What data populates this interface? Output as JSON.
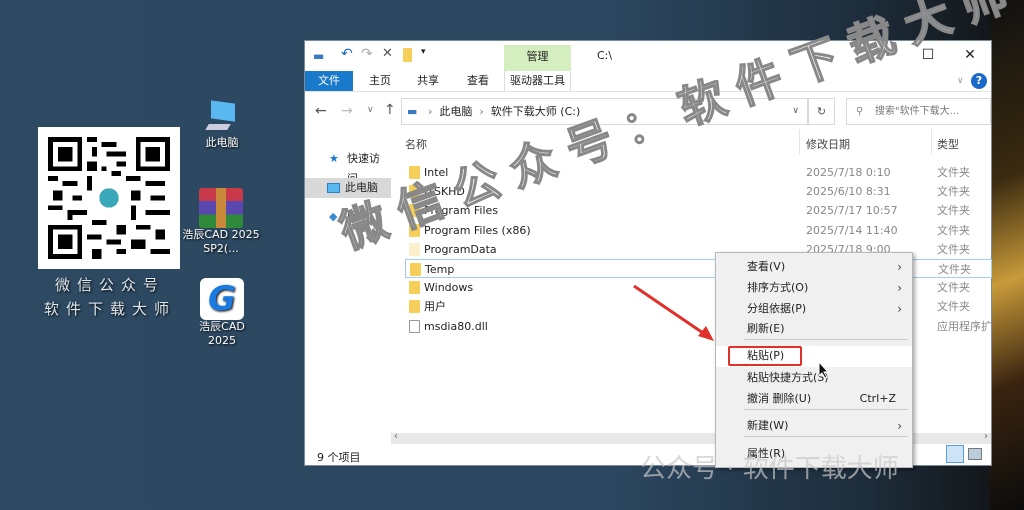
{
  "desktop": {
    "qr_caption": [
      "微信公众号",
      "软件下载大师"
    ],
    "icons": [
      {
        "label": "此电脑",
        "icon": "computer-icon"
      },
      {
        "label": "浩辰CAD 2025 SP2(...",
        "icon": "winrar-archive-icon"
      },
      {
        "label": "浩辰CAD 2025",
        "icon": "gstarcad-icon"
      }
    ]
  },
  "explorer": {
    "title": "C:\\",
    "manage_tab": "管理",
    "drive_tools_tab": "驱动器工具",
    "tabs": [
      "文件",
      "主页",
      "共享",
      "查看"
    ],
    "breadcrumb": [
      "此电脑",
      "软件下载大师 (C:)"
    ],
    "search_placeholder": "搜索\"软件下载大...",
    "nav": [
      "快速访问",
      "此电脑",
      "网络"
    ],
    "columns": [
      "名称",
      "修改日期",
      "类型"
    ],
    "rows": [
      {
        "name": "Intel",
        "date": "2025/7/18 0:10",
        "type": "文件夹"
      },
      {
        "name": "ITSKHD",
        "date": "2025/6/10 8:31",
        "type": "文件夹"
      },
      {
        "name": "Program Files",
        "date": "2025/7/17 10:57",
        "type": "文件夹"
      },
      {
        "name": "Program Files (x86)",
        "date": "2025/7/14 11:40",
        "type": "文件夹"
      },
      {
        "name": "ProgramData",
        "date": "2025/7/18 9:00",
        "type": "文件夹"
      },
      {
        "name": "Temp",
        "date": "",
        "type": "文件夹"
      },
      {
        "name": "Windows",
        "date": "",
        "type": "文件夹"
      },
      {
        "name": "用户",
        "date": "",
        "type": "文件夹"
      },
      {
        "name": "msdia80.dll",
        "date": "",
        "type": "应用程序扩"
      }
    ],
    "status": "9 个项目"
  },
  "context_menu": {
    "items": [
      {
        "label": "查看(V)",
        "submenu": true
      },
      {
        "label": "排序方式(O)",
        "submenu": true
      },
      {
        "label": "分组依据(P)",
        "submenu": true
      },
      {
        "label": "刷新(E)"
      },
      {
        "label": "粘贴(P)",
        "highlighted": true
      },
      {
        "label": "粘贴快捷方式(S)"
      },
      {
        "label": "撤消 删除(U)",
        "shortcut": "Ctrl+Z"
      },
      {
        "label": "新建(W)",
        "submenu": true
      },
      {
        "label": "属性(R)"
      }
    ]
  },
  "watermark": {
    "diagonal": "微信公众号：软件下载大师",
    "bottom": "公众号 · 软件下载大师"
  },
  "colors": {
    "accent": "#1979ca",
    "manage": "#d4eec0",
    "highlight_box": "#e0302a"
  }
}
